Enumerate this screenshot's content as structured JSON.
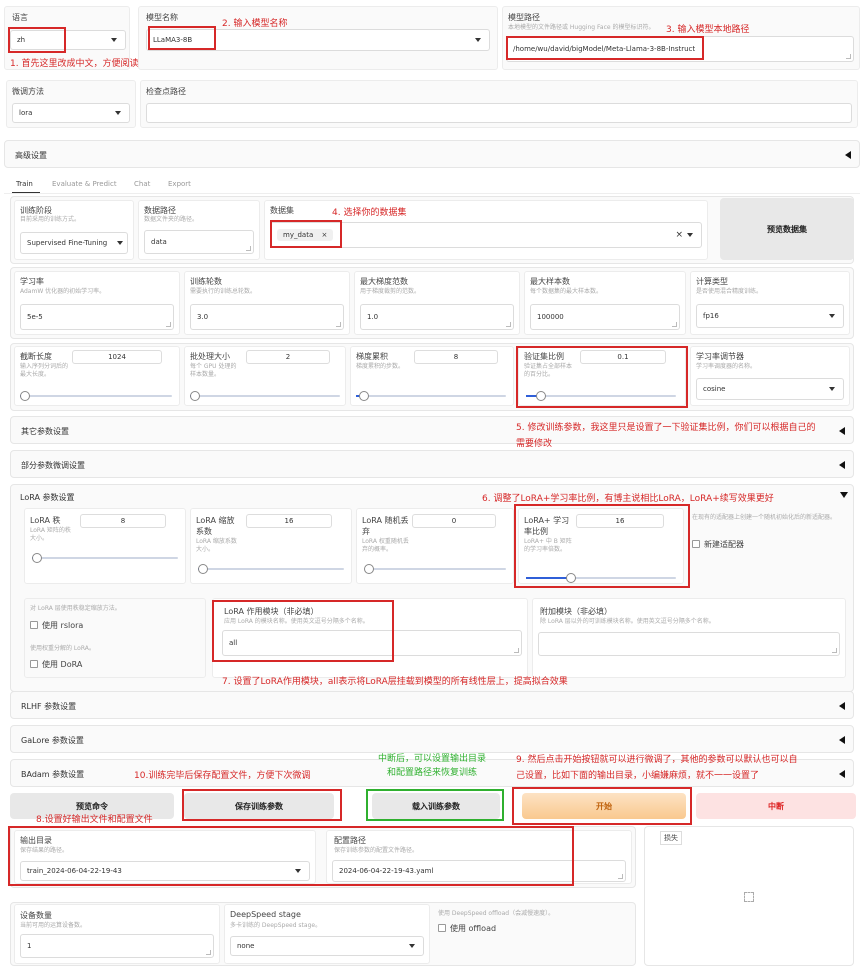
{
  "top": {
    "language": {
      "label": "语言",
      "value": "zh"
    },
    "model_name": {
      "label": "模型名称",
      "value": "LLaMA3-8B"
    },
    "model_path": {
      "label": "模型路径",
      "desc": "本地模型的文件路径或 Hugging Face 的模型标识符。",
      "value": "/home/wu/david/bigModel/Meta-Llama-3-8B-Instruct"
    },
    "finetune": {
      "label": "微调方法",
      "value": "lora"
    },
    "checkpoint": {
      "label": "检查点路径",
      "value": ""
    },
    "advanced": "高级设置"
  },
  "tabs": [
    "Train",
    "Evaluate & Predict",
    "Chat",
    "Export"
  ],
  "train": {
    "stage": {
      "label": "训练阶段",
      "desc": "目前采用的训练方式。",
      "value": "Supervised Fine-Tuning"
    },
    "dataset_dir": {
      "label": "数据路径",
      "desc": "数据文件夹的路径。",
      "value": "data"
    },
    "dataset": {
      "label": "数据集",
      "value": "my_data",
      "x": "×"
    },
    "preview_dataset": "预览数据集",
    "lr": {
      "label": "学习率",
      "desc": "AdamW 优化器的初始学习率。",
      "value": "5e-5"
    },
    "epochs": {
      "label": "训练轮数",
      "desc": "需要执行的训练总轮数。",
      "value": "3.0"
    },
    "max_grad": {
      "label": "最大梯度范数",
      "desc": "用于梯度裁剪的范数。",
      "value": "1.0"
    },
    "max_samples": {
      "label": "最大样本数",
      "desc": "每个数据集的最大样本数。",
      "value": "100000"
    },
    "compute_type": {
      "label": "计算类型",
      "desc": "是否使用混合精度训练。",
      "value": "fp16"
    },
    "cutoff": {
      "label": "截断长度",
      "desc": "输入序列分词后的最大长度。",
      "value": "1024",
      "fraction": 0.03
    },
    "batch": {
      "label": "批处理大小",
      "desc": "每个 GPU 处理的样本数量。",
      "value": "2",
      "fraction": 0.02
    },
    "grad_acc": {
      "label": "梯度累积",
      "desc": "梯度累积的步数。",
      "value": "8",
      "fraction": 0.05
    },
    "val_size": {
      "label": "验证集比例",
      "desc": "验证集占全部样本的百分比。",
      "value": "0.1",
      "fraction": 0.1
    },
    "scheduler": {
      "label": "学习率调节器",
      "desc": "学习率调度器的名称。",
      "value": "cosine"
    }
  },
  "sections": {
    "other": "其它参数设置",
    "partial": "部分参数微调设置",
    "lora": "LoRA 参数设置",
    "rlhf": "RLHF 参数设置",
    "galore": "GaLore 参数设置",
    "badam": "BAdam 参数设置"
  },
  "lora": {
    "rank": {
      "label": "LoRA 秩",
      "desc": "LoRA 矩阵的秩大小。",
      "value": "8",
      "fraction": 0.03
    },
    "alpha": {
      "label": "LoRA 缩放系数",
      "desc": "LoRA 缩放系数大小。",
      "value": "16",
      "fraction": 0.03
    },
    "dropout": {
      "label": "LoRA 随机丢弃",
      "desc": "LoRA 权重随机丢弃的概率。",
      "value": "0",
      "fraction": 0.0
    },
    "plus_lr": {
      "label": "LoRA+ 学习率比例",
      "desc": "LoRA+ 中 B 矩阵的学习率倍数。",
      "value": "16",
      "fraction": 0.3
    },
    "new_adapter_desc": "在现有的适配器上创建一个随机初始化后的新适配器。",
    "new_adapter": "新建适配器",
    "rslora_desc": "对 LoRA 层使用秩稳定缩放方法。",
    "rslora": "使用 rslora",
    "dora_desc": "使用权重分解的 LoRA。",
    "dora": "使用 DoRA",
    "target": {
      "label": "LoRA 作用模块（非必填）",
      "desc": "应用 LoRA 的模块名称。使用英文逗号分隔多个名称。",
      "value": "all"
    },
    "extra": {
      "label": "附加模块（非必填）",
      "desc": "除 LoRA 层以外的可训练模块名称。使用英文逗号分隔多个名称。",
      "value": ""
    }
  },
  "buttons": {
    "preview_cmd": "预览命令",
    "save_args": "保存训练参数",
    "load_args": "载入训练参数",
    "start": "开始",
    "abort": "中断"
  },
  "output": {
    "output_dir": {
      "label": "输出目录",
      "desc": "保存结果的路径。",
      "value": "train_2024-06-04-22-19-43"
    },
    "config_path": {
      "label": "配置路径",
      "desc": "保存训练参数的配置文件路径。",
      "value": "2024-06-04-22-19-43.yaml"
    },
    "loss": "损失"
  },
  "bottom": {
    "devices": {
      "label": "设备数量",
      "desc": "当前可用的运算设备数。",
      "value": "1"
    },
    "deepspeed": {
      "label": "DeepSpeed stage",
      "desc": "多卡训练的 DeepSpeed stage。",
      "value": "none"
    },
    "offload_desc": "使用 DeepSpeed offload（会减慢速度）。",
    "offload": "使用 offload"
  },
  "annotations": {
    "a1": "1. 首先这里改成中文，方便阅读",
    "a2": "2. 输入模型名称",
    "a3": "3. 输入模型本地路径",
    "a4": "4. 选择你的数据集",
    "a5": "5. 修改训练参数，我这里只是设置了一下验证集比例，你们可以根据自己的",
    "a5b": "需要修改",
    "a6": "6. 调整了LoRA+学习率比例，有博主说相比LoRA，LoRA+续写效果更好",
    "a7": "7. 设置了LoRA作用模块，all表示将LoRA层挂载到模型的所有线性层上，提高拟合效果",
    "a8": "8.设置好输出文件和配置文件",
    "a9": "9. 然后点击开始按钮就可以进行微调了，其他的参数可以默认也可以自",
    "a9b": "己设置，比如下面的输出目录，小编嫌麻烦，就不一一设置了",
    "a10": "10.训练完毕后保存配置文件，方便下次微调",
    "green1": "中断后，可以设置输出目录",
    "green2": "和配置路径来恢复训练"
  }
}
